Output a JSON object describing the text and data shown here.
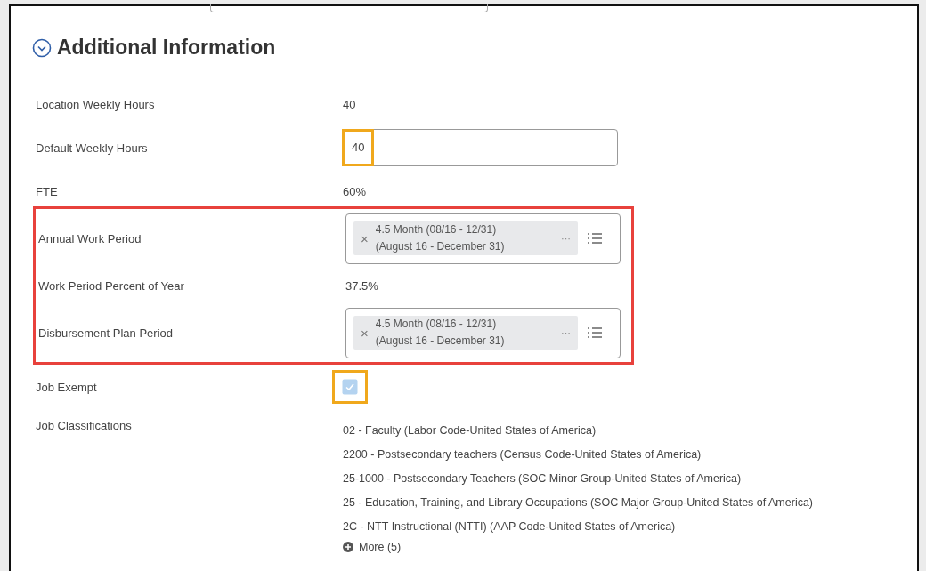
{
  "section": {
    "title": "Additional Information",
    "expanded": true
  },
  "rows": [
    {
      "kind": "text",
      "label": "Location Weekly Hours",
      "value": "40"
    },
    {
      "kind": "input",
      "label": "Default Weekly Hours",
      "value": "40",
      "highlighted": true
    },
    {
      "kind": "text",
      "label": "FTE",
      "value": "60%"
    },
    {
      "kind": "group",
      "outlined": true,
      "rows": [
        {
          "kind": "multiselect",
          "label": "Annual Work Period",
          "chip": {
            "line1": "4.5 Month (08/16 - 12/31)",
            "line2": "(August 16 - December 31)",
            "remove": "×",
            "more": "···"
          }
        },
        {
          "kind": "text",
          "label": "Work Period Percent of Year",
          "value": "37.5%"
        },
        {
          "kind": "multiselect",
          "label": "Disbursement Plan Period",
          "chip": {
            "line1": "4.5 Month (08/16 - 12/31)",
            "line2": "(August 16 - December 31)",
            "remove": "×",
            "more": "···"
          }
        }
      ]
    },
    {
      "kind": "checkbox",
      "label": "Job Exempt",
      "checked": true,
      "disabled": true,
      "highlighted": true
    },
    {
      "kind": "list",
      "label": "Job Classifications",
      "items": [
        "02 - Faculty (Labor Code-United States of America)",
        "2200 - Postsecondary teachers (Census Code-United States of America)",
        "25-1000 - Postsecondary Teachers (SOC Minor Group-United States of America)",
        "25 - Education, Training, and Library Occupations (SOC Major Group-United States of America)",
        "2C - NTT Instructional (NTTI) (AAP Code-United States of America)"
      ],
      "more": "More (5)"
    }
  ]
}
